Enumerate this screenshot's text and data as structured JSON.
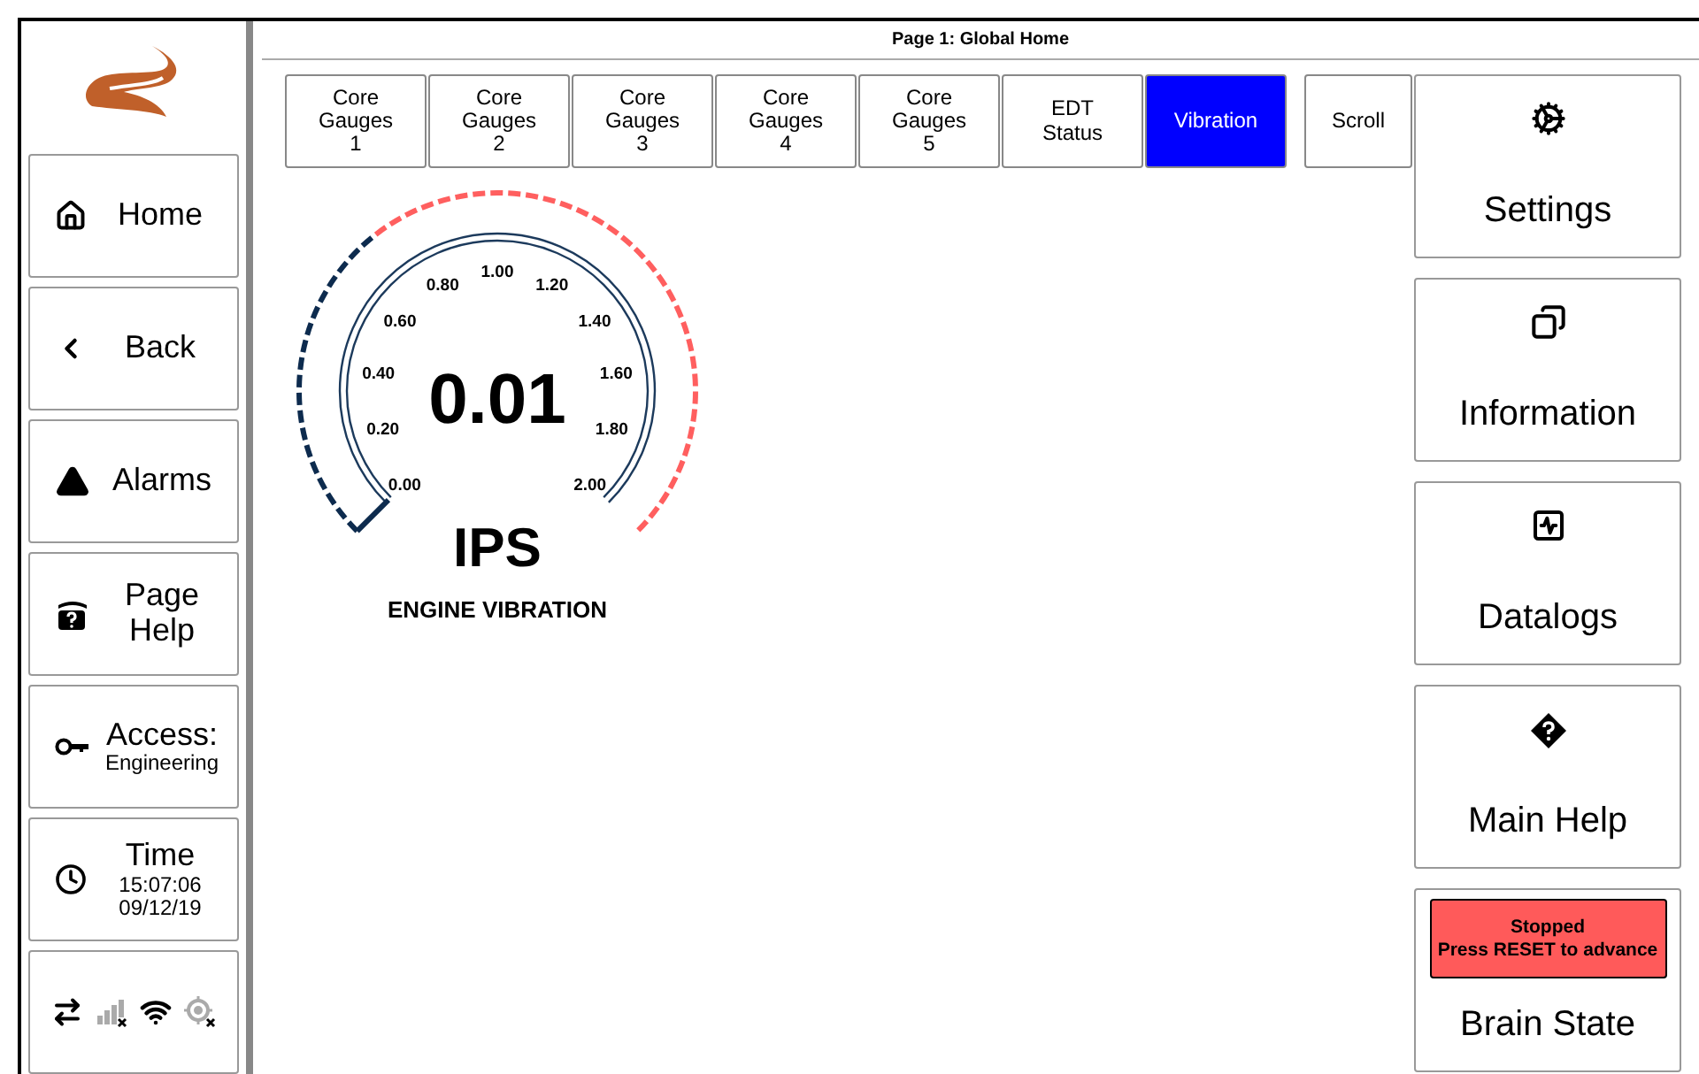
{
  "sidebar": {
    "items": [
      {
        "kind": "home",
        "label": "Home"
      },
      {
        "kind": "back",
        "label": "Back"
      },
      {
        "kind": "alarms",
        "label": "Alarms"
      },
      {
        "kind": "page_help",
        "label": "Page Help"
      },
      {
        "kind": "access",
        "label": "Access:",
        "detail": [
          "Engineering"
        ]
      },
      {
        "kind": "time",
        "label": "Time",
        "detail": [
          "15:07:06",
          "09/12/19"
        ]
      }
    ],
    "status_icons": [
      {
        "kind": "transfer",
        "active": true
      },
      {
        "kind": "cellular",
        "active": false
      },
      {
        "kind": "wifi",
        "active": true
      },
      {
        "kind": "gps",
        "active": false
      }
    ]
  },
  "page_title": "Page 1: Global Home",
  "tabs": [
    {
      "label": [
        "Core",
        "Gauges",
        "1"
      ],
      "selected": false
    },
    {
      "label": [
        "Core",
        "Gauges",
        "2"
      ],
      "selected": false
    },
    {
      "label": [
        "Core",
        "Gauges",
        "3"
      ],
      "selected": false
    },
    {
      "label": [
        "Core",
        "Gauges",
        "4"
      ],
      "selected": false
    },
    {
      "label": [
        "Core",
        "Gauges",
        "5"
      ],
      "selected": false
    },
    {
      "label": [
        "EDT",
        "Status"
      ],
      "selected": false
    },
    {
      "label": [
        "Vibration"
      ],
      "selected": true
    }
  ],
  "scroll_button": "Scroll",
  "gauge": {
    "value": "0.01",
    "unit": "IPS",
    "title": "ENGINE VIBRATION",
    "scale_labels": [
      "0.00",
      "0.20",
      "0.40",
      "0.60",
      "0.80",
      "1.00",
      "1.20",
      "1.40",
      "1.60",
      "1.80",
      "2.00"
    ]
  },
  "right_buttons": [
    {
      "kind": "settings",
      "label": "Settings"
    },
    {
      "kind": "information",
      "label": "Information"
    },
    {
      "kind": "datalogs",
      "label": "Datalogs"
    },
    {
      "kind": "help",
      "label": "Main Help"
    },
    {
      "kind": "status",
      "label": "Brain State",
      "status": [
        "Stopped",
        "Press RESET to advance"
      ]
    }
  ]
}
